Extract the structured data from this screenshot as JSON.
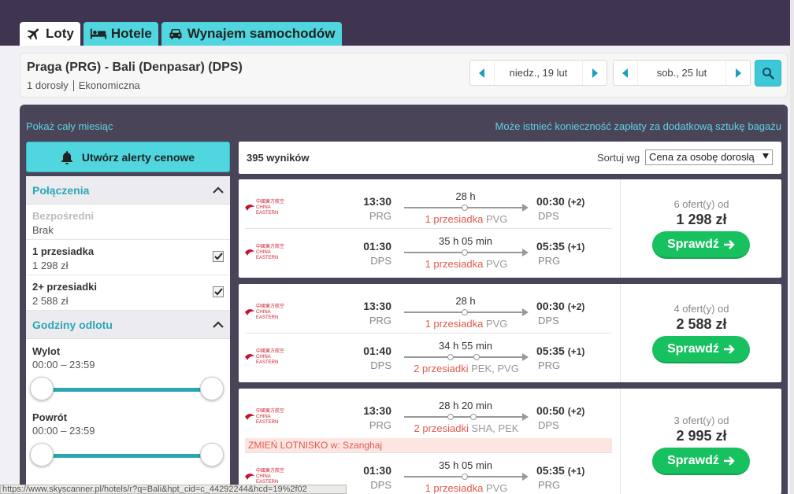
{
  "header": {
    "tabs": [
      {
        "label": "Loty",
        "icon": "plane-icon",
        "active": true
      },
      {
        "label": "Hotele",
        "icon": "bed-icon",
        "active": false
      },
      {
        "label": "Wynajem samochodów",
        "icon": "car-icon",
        "active": false
      }
    ]
  },
  "search": {
    "route": "Praga (PRG) - Bali (Denpasar) (DPS)",
    "passengers": "1 dorosły",
    "cabin": "Ekonomiczna",
    "depart_date": "niedz., 19 lut",
    "return_date": "sob., 25 lut"
  },
  "links": {
    "whole_month": "Pokaż cały miesiąc",
    "baggage_notice": "Może istnieć konieczność zapłaty za dodatkową sztukę bagażu"
  },
  "alerts": {
    "label": "Utwórz alerty cenowe"
  },
  "filters": {
    "connections_title": "Połączenia",
    "stops": [
      {
        "label": "Bezpośredni",
        "value": "Brak",
        "checked": false,
        "disabled": true
      },
      {
        "label": "1 przesiadka",
        "value": "1 298 zł",
        "checked": true,
        "disabled": false
      },
      {
        "label": "2+ przesiadki",
        "value": "2 588 zł",
        "checked": true,
        "disabled": false
      }
    ],
    "times_title": "Godziny odlotu",
    "outbound_label": "Wylot",
    "outbound_range": "00:00 – 23:59",
    "inbound_label": "Powrót",
    "inbound_range": "00:00 – 23:59"
  },
  "results": {
    "count": "395 wyników",
    "sort_label": "Sortuj wg",
    "sort_value": "Cena za osobę dorosłą",
    "cards": [
      {
        "legs": [
          {
            "dep_time": "13:30",
            "dep_air": "PRG",
            "duration": "28 h",
            "stops_red": "1 przesiadka",
            "stops_air": "PVG",
            "arr_time": "00:30",
            "plus": "(+2)",
            "arr_air": "DPS"
          },
          {
            "dep_time": "01:30",
            "dep_air": "DPS",
            "duration": "35 h 05 min",
            "stops_red": "1 przesiadka",
            "stops_air": "PVG",
            "arr_time": "05:35",
            "plus": "(+1)",
            "arr_air": "PRG"
          }
        ],
        "offers": "6 ofert(y) od",
        "price": "1 298 zł",
        "button": "Sprawdź"
      },
      {
        "legs": [
          {
            "dep_time": "13:30",
            "dep_air": "PRG",
            "duration": "28 h",
            "stops_red": "1 przesiadka",
            "stops_air": "PVG",
            "arr_time": "00:30",
            "plus": "(+2)",
            "arr_air": "DPS"
          },
          {
            "dep_time": "01:40",
            "dep_air": "DPS",
            "duration": "34 h 55 min",
            "stops_red": "2 przesiadki",
            "stops_air": "PEK, PVG",
            "arr_time": "05:35",
            "plus": "(+1)",
            "arr_air": "PRG"
          }
        ],
        "offers": "4 ofert(y) od",
        "price": "2 588 zł",
        "button": "Sprawdź"
      },
      {
        "legs": [
          {
            "dep_time": "13:30",
            "dep_air": "PRG",
            "duration": "28 h 20 min",
            "stops_red": "2 przesiadki",
            "stops_air": "SHA, PEK",
            "arr_time": "00:50",
            "plus": "(+2)",
            "arr_air": "DPS"
          },
          {
            "dep_time": "01:30",
            "dep_air": "DPS",
            "duration": "35 h 05 min",
            "stops_red": "1 przesiadka",
            "stops_air": "PVG",
            "arr_time": "05:35",
            "plus": "(+1)",
            "arr_air": "PRG"
          }
        ],
        "warning": "ZMIEŃ LOTNISKO w: Szanghaj",
        "offers": "3 ofert(y) od",
        "price": "2 995 zł",
        "button": "Sprawdź"
      }
    ],
    "airline_text": "中國東方航空 CHINA EASTERN"
  },
  "statusbar": {
    "url": "https://www.skyscanner.pl/hotels/r?q=Bali&hpt_cid=c_44292244&hcd=19%2f02"
  },
  "colors": {
    "header_bg": "#3f3550",
    "accent": "#4fd6df",
    "button_green": "#18c160",
    "warning_red": "#e05a4f"
  }
}
